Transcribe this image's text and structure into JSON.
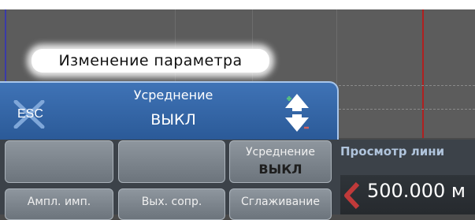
{
  "dialog": {
    "header_label": "Изменение параметра",
    "esc_label": "ESC",
    "param_name": "Усреднение",
    "param_value": "ВЫКЛ"
  },
  "softkeys": [
    {
      "label": ""
    },
    {
      "label": ""
    },
    {
      "label": "Усреднение",
      "value": "ВЫКЛ"
    },
    {
      "label": "Ампл. имп."
    },
    {
      "label": "Вых. сопр."
    },
    {
      "label": "Сглаживание"
    }
  ],
  "view": {
    "title": "Просмотр лини",
    "distance": "500.000 м"
  },
  "icons": {
    "esc": "close-x-icon",
    "updown": "up-down-arrows-icon",
    "left_arrow": "left-arrow-icon"
  },
  "colors": {
    "dialog_bg": "#3a6aab",
    "cursor_red": "#b02020",
    "cursor_blue": "#3a3aa8",
    "arrow_green": "#55c080",
    "arrow_red": "#d06060"
  }
}
